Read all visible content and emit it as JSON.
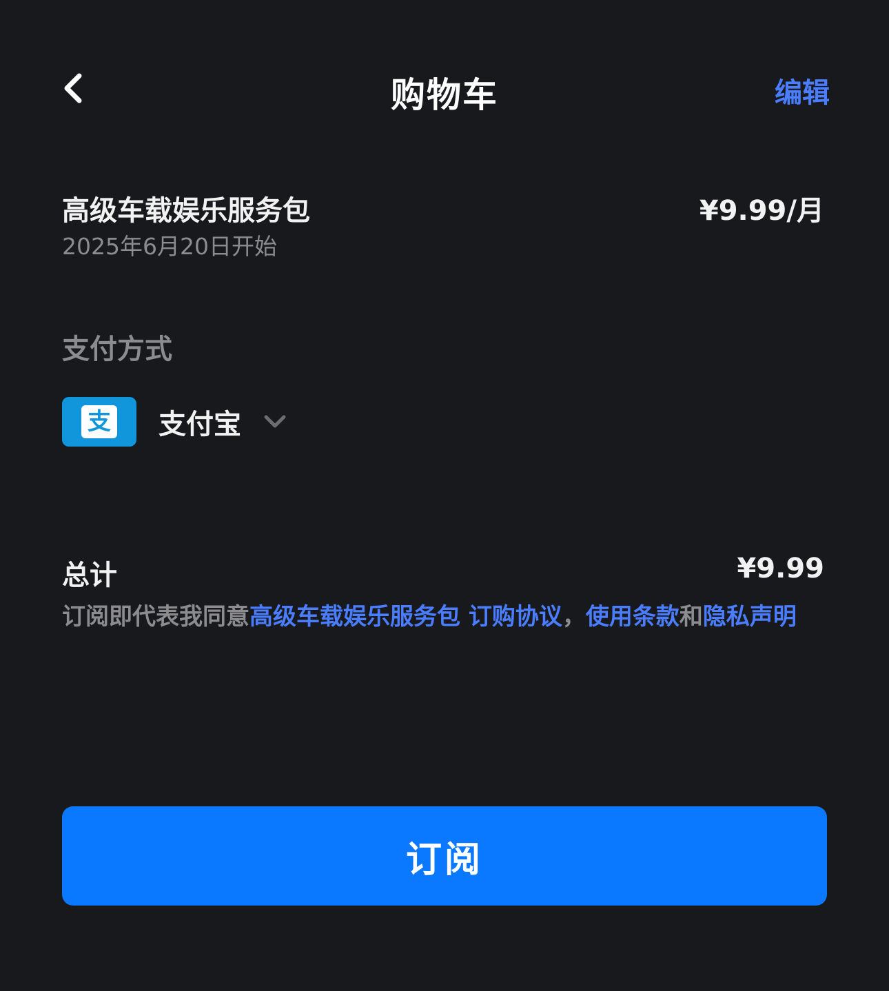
{
  "nav": {
    "back_icon": "chevron-left-icon",
    "title": "购物车",
    "edit_label": "编辑"
  },
  "item": {
    "name": "高级车载娱乐服务包",
    "start_date": "2025年6月20日开始",
    "price": "¥9.99/月"
  },
  "payment": {
    "label": "支付方式",
    "method_icon": "alipay-logo-icon",
    "method_icon_glyph": "支",
    "method_name": "支付宝",
    "dropdown_icon": "chevron-down-icon"
  },
  "total": {
    "label": "总计",
    "value": "¥9.99"
  },
  "agreement": {
    "prefix": "订阅即代表我同意",
    "link_purchase": "高级车载娱乐服务包 订购协议",
    "sep1": "，",
    "link_terms": "使用条款",
    "sep2": "和",
    "link_privacy": "隐私声明"
  },
  "subscribe_label": "订阅",
  "colors": {
    "background": "#17191c",
    "accent": "#4a7dff",
    "button": "#0a78ff",
    "alipay": "#1296db",
    "muted_text": "#8c8c8f"
  }
}
